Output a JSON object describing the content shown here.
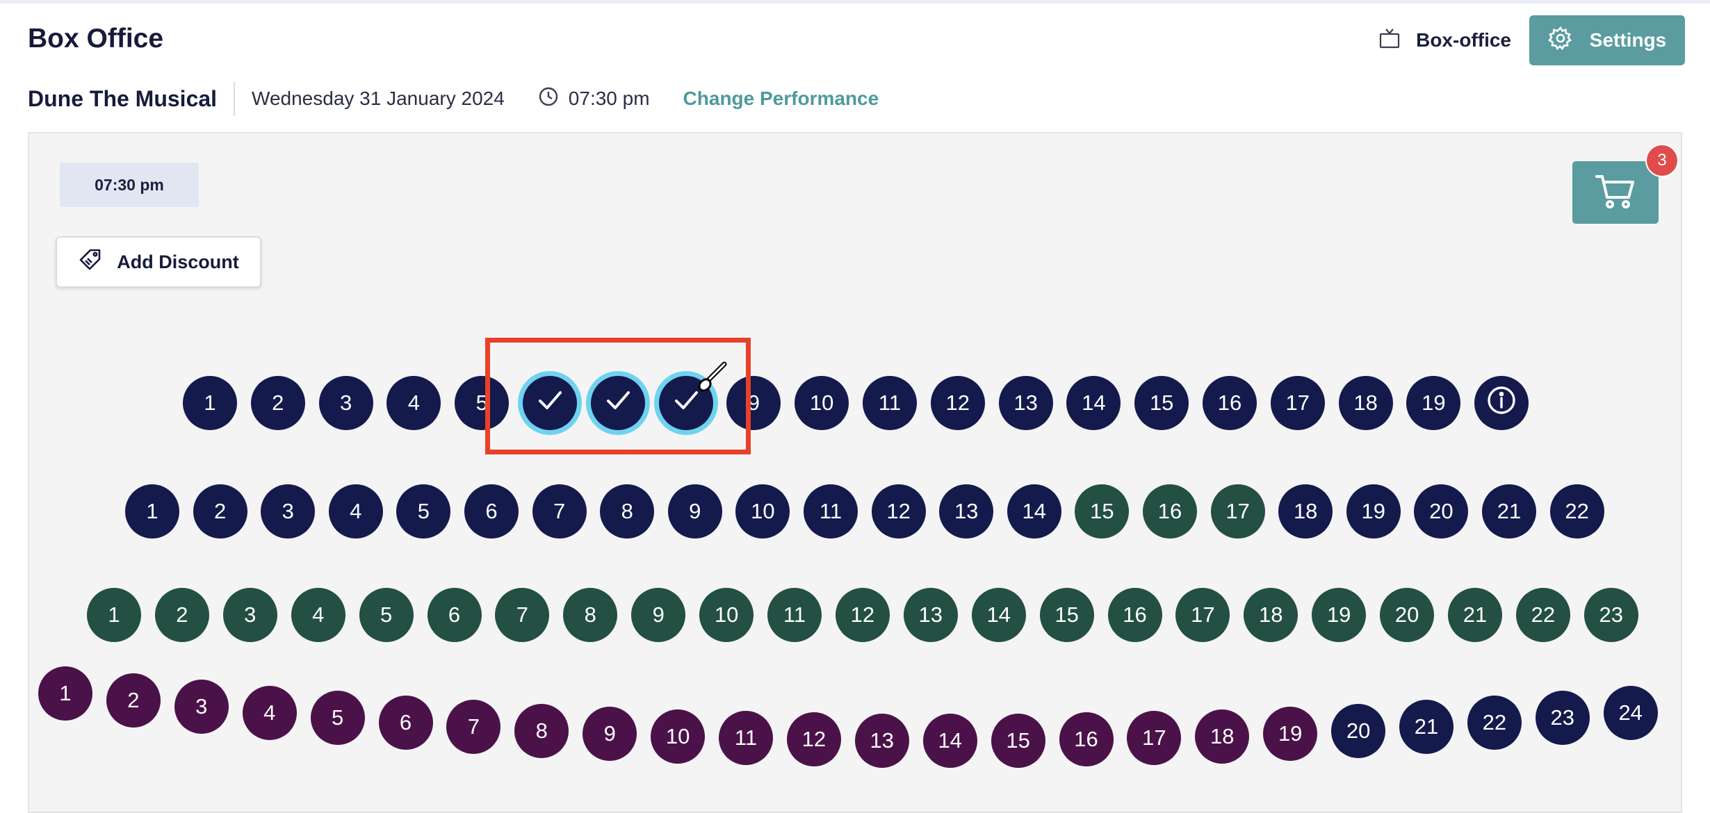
{
  "header": {
    "title": "Box Office",
    "venue_label": "Box-office",
    "venue_icon": "tv-icon",
    "settings_label": "Settings",
    "settings_icon": "gear-icon"
  },
  "performance": {
    "show_name": "Dune The Musical",
    "date": "Wednesday 31 January 2024",
    "time": "07:30 pm",
    "time_icon": "clock-icon",
    "change_label": "Change Performance"
  },
  "panel": {
    "time_chip": "07:30 pm",
    "discount_label": "Add Discount",
    "discount_icon": "tag-icon",
    "cart_icon": "cart-icon",
    "cart_count": "3"
  },
  "colors": {
    "accent": "#5a9c9f",
    "seat_navy": "#141a4c",
    "seat_green": "#244f43",
    "seat_purple": "#4b1249",
    "selected_ring": "#6ed3ef",
    "highlight_box": "#e8412a",
    "badge": "#e04c4c"
  },
  "seat_map": {
    "rows": [
      {
        "seats": [
          {
            "label": "1",
            "color": "navy"
          },
          {
            "label": "2",
            "color": "navy"
          },
          {
            "label": "3",
            "color": "navy"
          },
          {
            "label": "4",
            "color": "navy"
          },
          {
            "label": "5",
            "color": "navy"
          },
          {
            "label": "",
            "color": "navy",
            "selected": true
          },
          {
            "label": "",
            "color": "navy",
            "selected": true
          },
          {
            "label": "",
            "color": "navy",
            "selected": true
          },
          {
            "label": "9",
            "color": "navy"
          },
          {
            "label": "10",
            "color": "navy"
          },
          {
            "label": "11",
            "color": "navy"
          },
          {
            "label": "12",
            "color": "navy"
          },
          {
            "label": "13",
            "color": "navy"
          },
          {
            "label": "14",
            "color": "navy"
          },
          {
            "label": "15",
            "color": "navy"
          },
          {
            "label": "16",
            "color": "navy"
          },
          {
            "label": "17",
            "color": "navy"
          },
          {
            "label": "18",
            "color": "navy"
          },
          {
            "label": "19",
            "color": "navy"
          },
          {
            "label": "",
            "color": "navy",
            "icon": "info-icon"
          }
        ]
      },
      {
        "seats": [
          {
            "label": "1",
            "color": "navy"
          },
          {
            "label": "2",
            "color": "navy"
          },
          {
            "label": "3",
            "color": "navy"
          },
          {
            "label": "4",
            "color": "navy"
          },
          {
            "label": "5",
            "color": "navy"
          },
          {
            "label": "6",
            "color": "navy"
          },
          {
            "label": "7",
            "color": "navy"
          },
          {
            "label": "8",
            "color": "navy"
          },
          {
            "label": "9",
            "color": "navy"
          },
          {
            "label": "10",
            "color": "navy"
          },
          {
            "label": "11",
            "color": "navy"
          },
          {
            "label": "12",
            "color": "navy"
          },
          {
            "label": "13",
            "color": "navy"
          },
          {
            "label": "14",
            "color": "navy"
          },
          {
            "label": "15",
            "color": "green"
          },
          {
            "label": "16",
            "color": "green"
          },
          {
            "label": "17",
            "color": "green"
          },
          {
            "label": "18",
            "color": "navy"
          },
          {
            "label": "19",
            "color": "navy"
          },
          {
            "label": "20",
            "color": "navy"
          },
          {
            "label": "21",
            "color": "navy"
          },
          {
            "label": "22",
            "color": "navy"
          }
        ]
      },
      {
        "seats": [
          {
            "label": "1",
            "color": "green"
          },
          {
            "label": "2",
            "color": "green"
          },
          {
            "label": "3",
            "color": "green"
          },
          {
            "label": "4",
            "color": "green"
          },
          {
            "label": "5",
            "color": "green"
          },
          {
            "label": "6",
            "color": "green"
          },
          {
            "label": "7",
            "color": "green"
          },
          {
            "label": "8",
            "color": "green"
          },
          {
            "label": "9",
            "color": "green"
          },
          {
            "label": "10",
            "color": "green"
          },
          {
            "label": "11",
            "color": "green"
          },
          {
            "label": "12",
            "color": "green"
          },
          {
            "label": "13",
            "color": "green"
          },
          {
            "label": "14",
            "color": "green"
          },
          {
            "label": "15",
            "color": "green"
          },
          {
            "label": "16",
            "color": "green"
          },
          {
            "label": "17",
            "color": "green"
          },
          {
            "label": "18",
            "color": "green"
          },
          {
            "label": "19",
            "color": "green"
          },
          {
            "label": "20",
            "color": "green"
          },
          {
            "label": "21",
            "color": "green"
          },
          {
            "label": "22",
            "color": "green"
          },
          {
            "label": "23",
            "color": "green"
          }
        ]
      },
      {
        "seats": [
          {
            "label": "1",
            "color": "purple"
          },
          {
            "label": "2",
            "color": "purple"
          },
          {
            "label": "3",
            "color": "purple"
          },
          {
            "label": "4",
            "color": "purple"
          },
          {
            "label": "5",
            "color": "purple"
          },
          {
            "label": "6",
            "color": "purple"
          },
          {
            "label": "7",
            "color": "purple"
          },
          {
            "label": "8",
            "color": "purple"
          },
          {
            "label": "9",
            "color": "purple"
          },
          {
            "label": "10",
            "color": "purple"
          },
          {
            "label": "11",
            "color": "purple"
          },
          {
            "label": "12",
            "color": "purple"
          },
          {
            "label": "13",
            "color": "purple"
          },
          {
            "label": "14",
            "color": "purple"
          },
          {
            "label": "15",
            "color": "purple"
          },
          {
            "label": "16",
            "color": "purple"
          },
          {
            "label": "17",
            "color": "purple"
          },
          {
            "label": "18",
            "color": "purple"
          },
          {
            "label": "19",
            "color": "purple"
          },
          {
            "label": "20",
            "color": "navy"
          },
          {
            "label": "21",
            "color": "navy"
          },
          {
            "label": "22",
            "color": "navy"
          },
          {
            "label": "23",
            "color": "navy"
          },
          {
            "label": "24",
            "color": "navy"
          }
        ]
      }
    ]
  }
}
